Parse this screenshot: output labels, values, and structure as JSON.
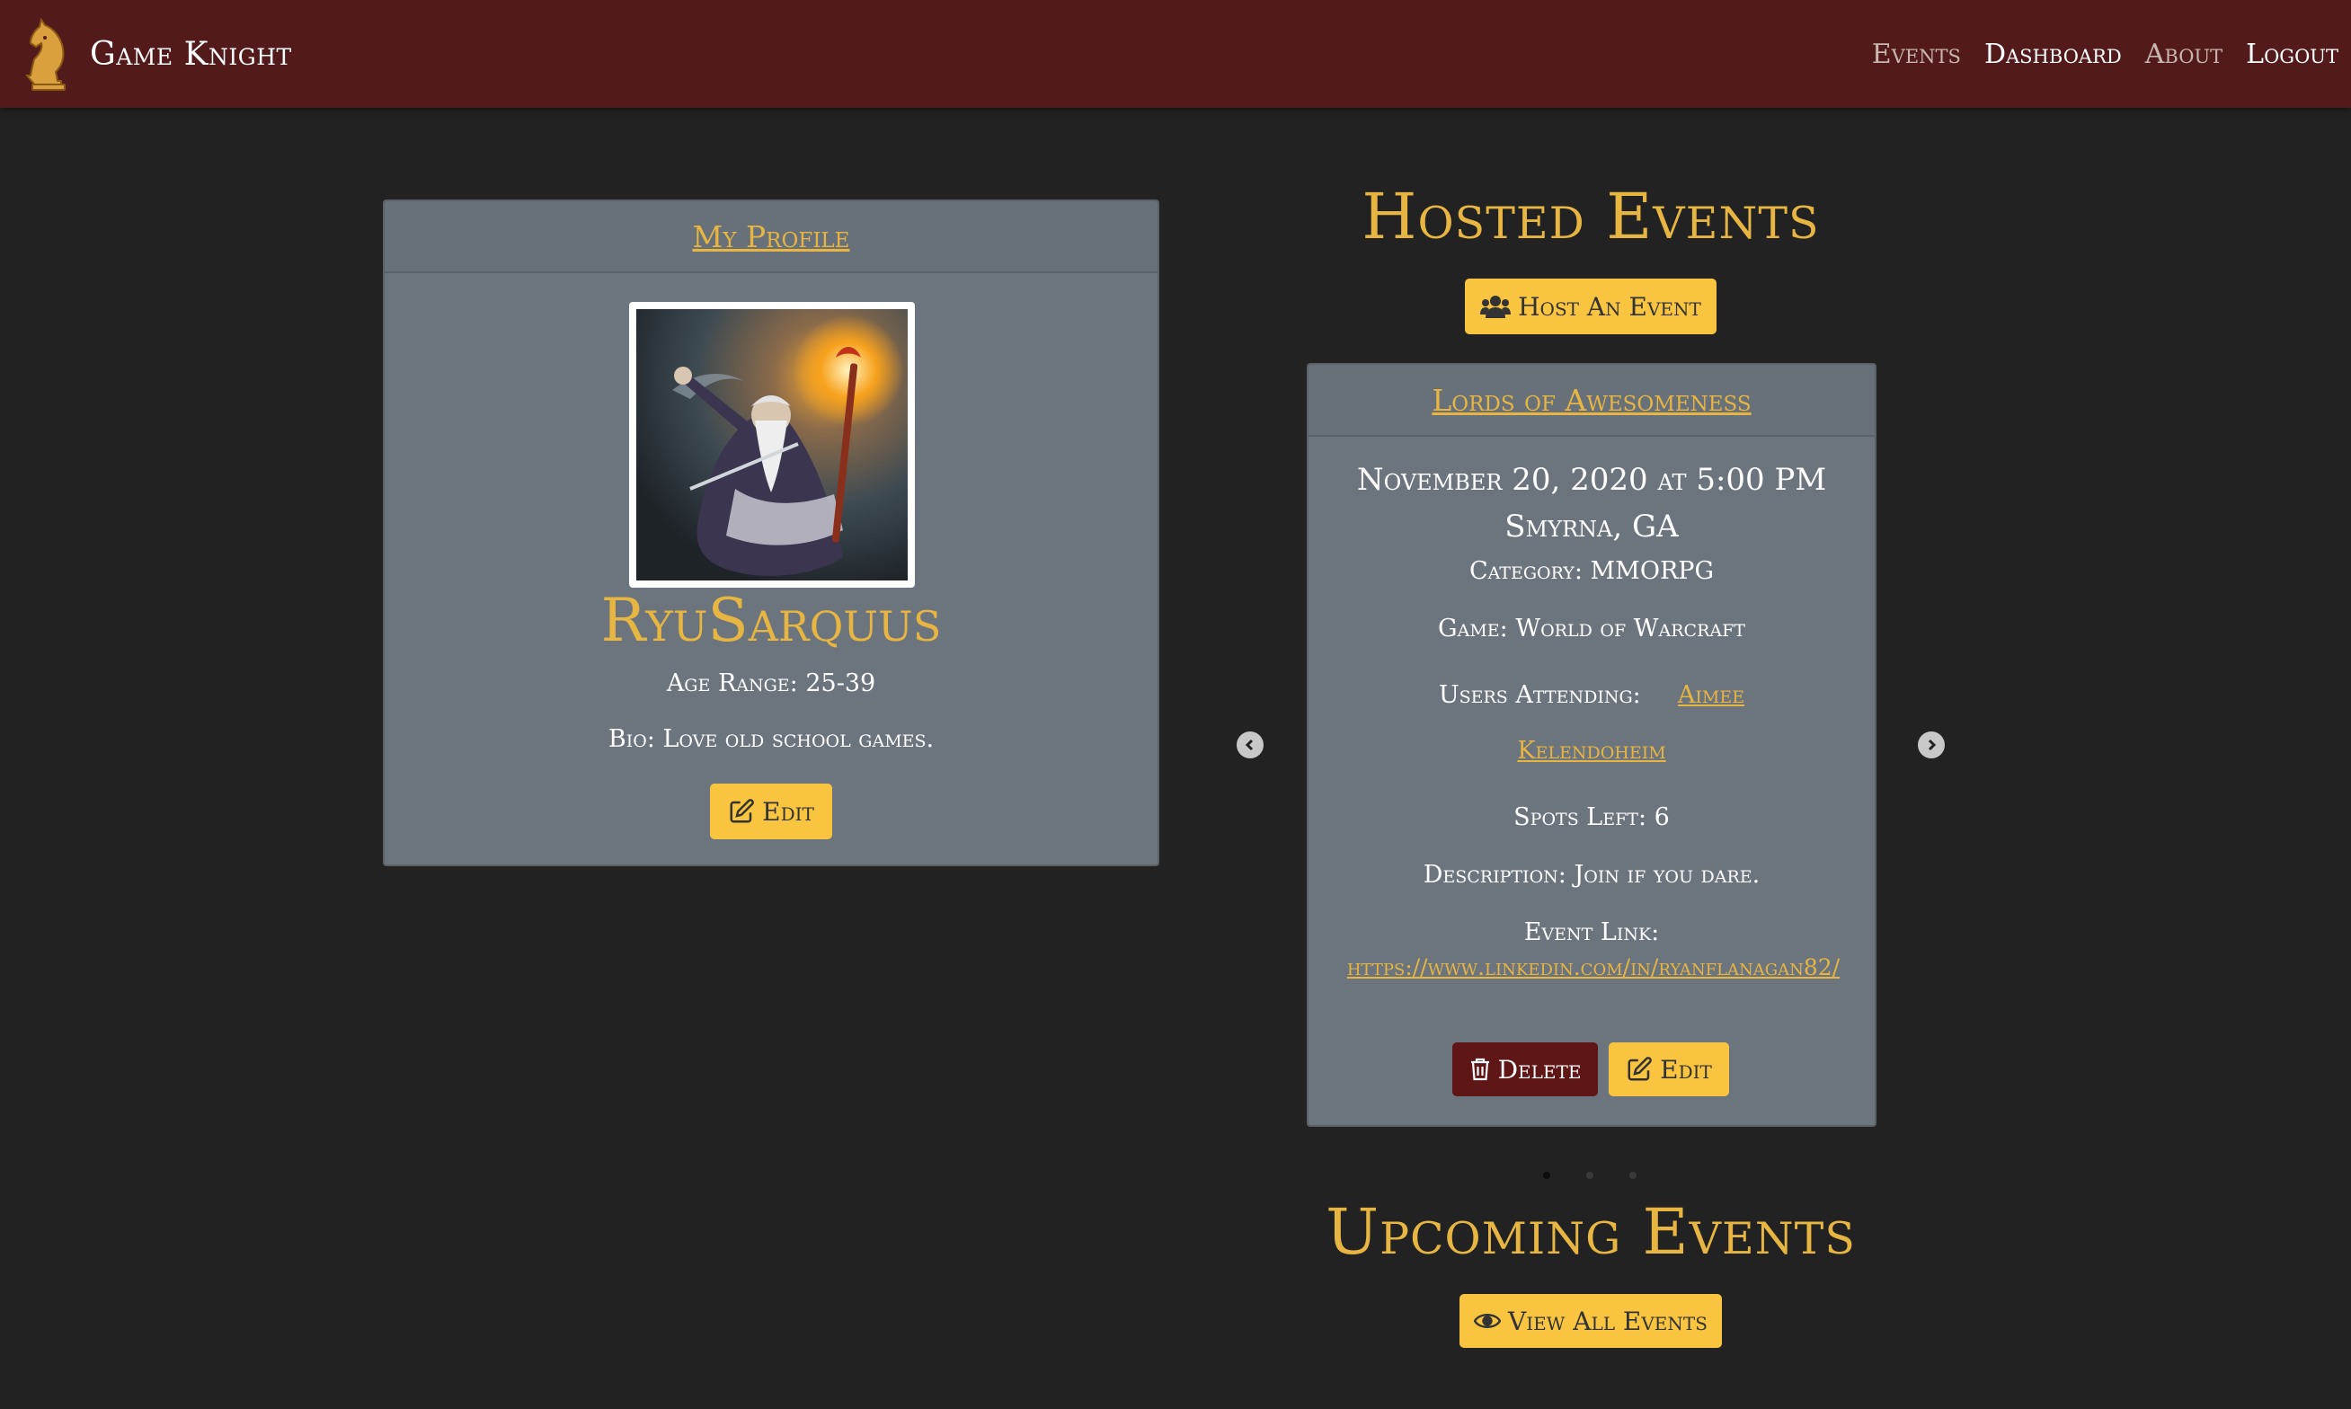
{
  "navbar": {
    "brand": "Game Knight",
    "links": [
      {
        "label": "Events",
        "active": false
      },
      {
        "label": "Dashboard",
        "active": true
      },
      {
        "label": "About",
        "active": false
      },
      {
        "label": "Logout",
        "active": true
      }
    ]
  },
  "profile": {
    "header": "My Profile",
    "username": "RyuSarquus",
    "age_range": "Age Range: 25-39",
    "bio": "Bio: Love old school games.",
    "edit_label": "Edit"
  },
  "hosted": {
    "title": "Hosted Events",
    "host_button": "Host An Event",
    "event": {
      "name": "Lords of Awesomeness",
      "datetime": "November 20, 2020 at 5:00 PM",
      "location": "Smyrna, GA",
      "category": "Category: MMORPG",
      "game": "Game: World of Warcraft",
      "users_label": "Users Attending:",
      "users": [
        "Aimee",
        "Kelendoheim"
      ],
      "spots_left": "Spots Left: 6",
      "description": "Description: Join if you dare.",
      "link_label": "Event Link:",
      "link_url": "https://www.linkedin.com/in/ryanflanagan82/",
      "delete_label": "Delete",
      "edit_label": "Edit"
    },
    "carousel": {
      "slides": 3,
      "active_slide": 1
    }
  },
  "upcoming": {
    "title": "Upcoming Events",
    "view_button": "View All Events"
  },
  "colors": {
    "navbar": "#531a1b",
    "background": "#222222",
    "card": "#6c757d",
    "gold": "#e7b542",
    "button_warning": "#f9c540",
    "button_danger": "#5f1617"
  },
  "icons": {
    "brand": "knight-chess-icon",
    "edit": "edit-icon",
    "users": "users-icon",
    "delete": "trash-icon",
    "view": "eye-icon",
    "prev": "chevron-left-icon",
    "next": "chevron-right-icon"
  }
}
